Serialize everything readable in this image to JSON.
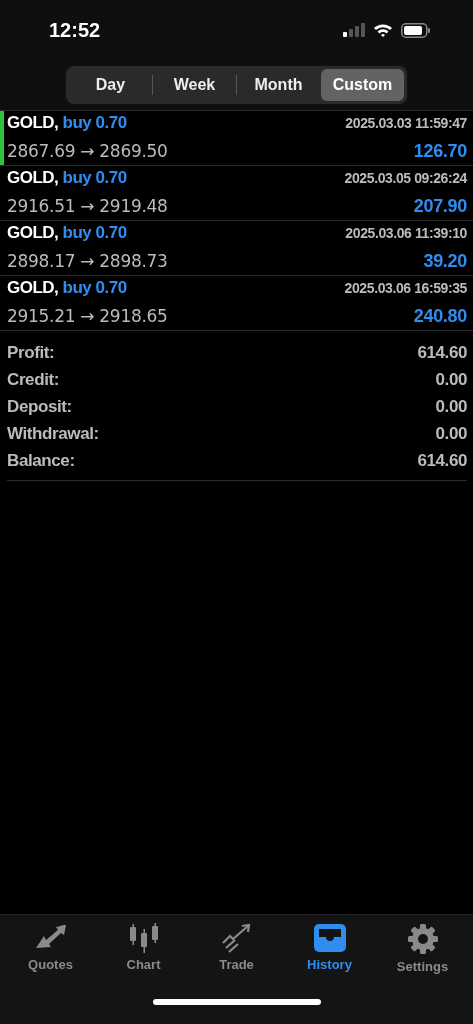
{
  "status_bar": {
    "time": "12:52"
  },
  "periods": [
    {
      "label": "Day",
      "selected": false
    },
    {
      "label": "Week",
      "selected": false
    },
    {
      "label": "Month",
      "selected": false
    },
    {
      "label": "Custom",
      "selected": true
    }
  ],
  "deals": [
    {
      "symbol": "GOLD,",
      "side": "buy 0.70",
      "time": "2025.03.03 11:59:47",
      "prices": "2867.69 → 2869.50",
      "profit": "126.70",
      "selected": true
    },
    {
      "symbol": "GOLD,",
      "side": "buy 0.70",
      "time": "2025.03.05 09:26:24",
      "prices": "2916.51 → 2919.48",
      "profit": "207.90",
      "selected": false
    },
    {
      "symbol": "GOLD,",
      "side": "buy 0.70",
      "time": "2025.03.06 11:39:10",
      "prices": "2898.17 → 2898.73",
      "profit": "39.20",
      "selected": false
    },
    {
      "symbol": "GOLD,",
      "side": "buy 0.70",
      "time": "2025.03.06 16:59:35",
      "prices": "2915.21 → 2918.65",
      "profit": "240.80",
      "selected": false
    }
  ],
  "summary": [
    {
      "label": "Profit:",
      "value": "614.60"
    },
    {
      "label": "Credit:",
      "value": "0.00"
    },
    {
      "label": "Deposit:",
      "value": "0.00"
    },
    {
      "label": "Withdrawal:",
      "value": "0.00"
    },
    {
      "label": "Balance:",
      "value": "614.60"
    }
  ],
  "tab_bar": [
    {
      "kind": "quotes",
      "label": "Quotes",
      "selected": false
    },
    {
      "kind": "chart",
      "label": "Chart",
      "selected": false
    },
    {
      "kind": "trade",
      "label": "Trade",
      "selected": false
    },
    {
      "kind": "history",
      "label": "History",
      "selected": true
    },
    {
      "kind": "settings",
      "label": "Settings",
      "selected": false
    }
  ]
}
